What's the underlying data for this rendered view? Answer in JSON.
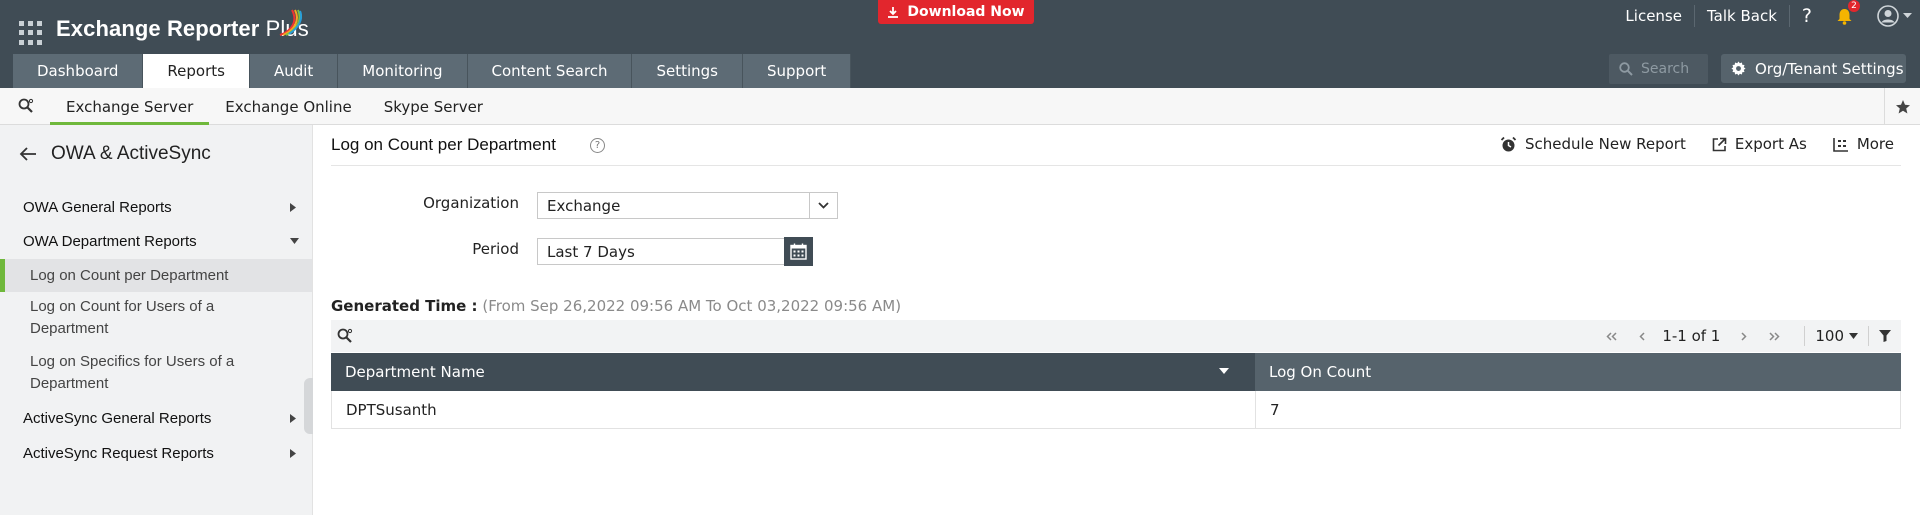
{
  "header": {
    "app_name": "Exchange Reporter",
    "app_name_suffix": "Plus",
    "download_label": "Download Now",
    "links": [
      "License",
      "Talk Back"
    ],
    "help_label": "?",
    "notification_count": "2",
    "main_tabs": [
      {
        "label": "Dashboard",
        "active": false
      },
      {
        "label": "Reports",
        "active": true
      },
      {
        "label": "Audit",
        "active": false
      },
      {
        "label": "Monitoring",
        "active": false
      },
      {
        "label": "Content Search",
        "active": false
      },
      {
        "label": "Settings",
        "active": false
      },
      {
        "label": "Support",
        "active": false
      }
    ],
    "search_placeholder": "Search",
    "org_settings_label": "Org/Tenant Settings"
  },
  "subnav": {
    "tabs": [
      {
        "label": "Exchange Server",
        "active": true
      },
      {
        "label": "Exchange Online",
        "active": false
      },
      {
        "label": "Skype Server",
        "active": false
      }
    ]
  },
  "sidebar": {
    "title": "OWA & ActiveSync",
    "categories": [
      {
        "label": "OWA General Reports"
      },
      {
        "label": "OWA Department Reports"
      },
      {
        "label": "ActiveSync General Reports"
      },
      {
        "label": "ActiveSync Request Reports"
      }
    ],
    "sub_items": [
      {
        "label": "Log on Count per Department",
        "active": true
      },
      {
        "label": "Log on Count for Users of a Department",
        "active": false
      },
      {
        "label": "Log on Specifics for Users of a Department",
        "active": false
      }
    ]
  },
  "content": {
    "title": "Log on Count per Department",
    "actions": {
      "schedule": "Schedule New Report",
      "export": "Export As",
      "more": "More"
    },
    "form": {
      "organization_label": "Organization",
      "organization_value": "Exchange",
      "period_label": "Period",
      "period_value": "Last 7 Days"
    },
    "generated_time_label": "Generated Time :",
    "generated_time_range": "(From Sep 26,2022 09:56 AM To Oct 03,2022 09:56 AM)",
    "pager": {
      "count": "1-1 of 1",
      "page_size": "100"
    },
    "table": {
      "columns": [
        "Department Name",
        "Log On Count"
      ],
      "rows": [
        [
          "DPTSusanth",
          "7"
        ]
      ]
    }
  },
  "colors": {
    "header_bg": "#404c55",
    "accent_green": "#6fb83b",
    "download_red": "#e2262d"
  }
}
